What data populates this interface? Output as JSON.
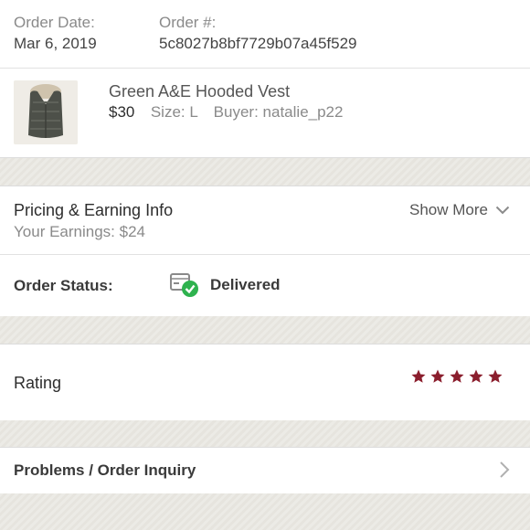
{
  "order": {
    "date_label": "Order Date:",
    "date_value": "Mar 6, 2019",
    "number_label": "Order #:",
    "number_value": "5c8027b8bf7729b07a45f529"
  },
  "item": {
    "name": "Green A&E Hooded Vest",
    "price": "$30",
    "size_label": "Size:",
    "size_value": "L",
    "buyer_label": "Buyer:",
    "buyer_value": "natalie_p22",
    "thumbnail_icon": "vest-photo"
  },
  "pricing": {
    "title": "Pricing & Earning Info",
    "earnings": "Your Earnings: $24",
    "show_more": "Show More",
    "chevron_icon": "chevron-down-icon"
  },
  "status": {
    "label": "Order Status:",
    "value": "Delivered",
    "icon": "delivered-box-icon",
    "check_color": "#2eb24e"
  },
  "rating": {
    "label": "Rating",
    "stars": 5,
    "star_color": "#8b1e2d"
  },
  "problems": {
    "label": "Problems / Order Inquiry",
    "chevron_icon": "chevron-right-icon"
  }
}
